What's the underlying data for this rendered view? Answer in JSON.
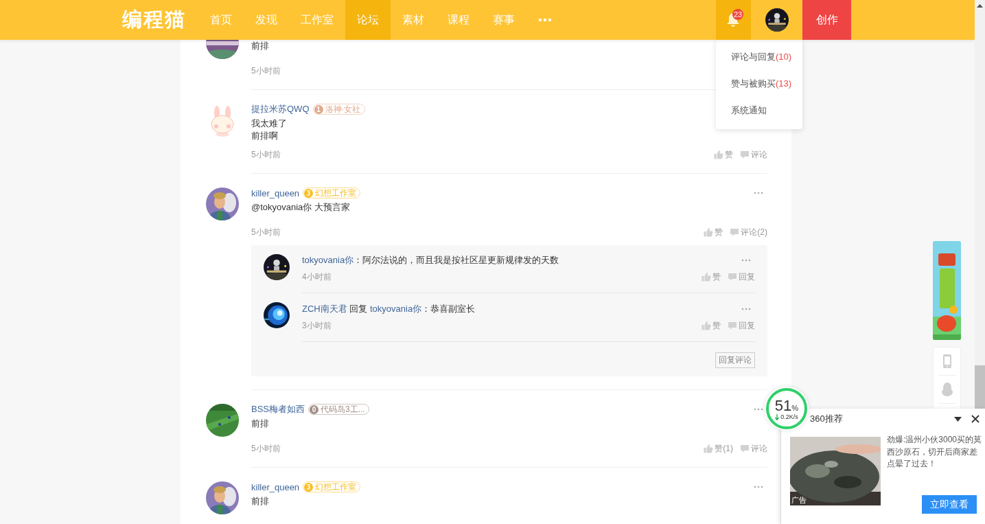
{
  "header": {
    "logo": "编程猫",
    "nav": [
      {
        "label": "首页",
        "selected": false
      },
      {
        "label": "发现",
        "selected": false
      },
      {
        "label": "工作室",
        "selected": false
      },
      {
        "label": "论坛",
        "selected": true
      },
      {
        "label": "素材",
        "selected": false
      },
      {
        "label": "课程",
        "selected": false
      },
      {
        "label": "赛事",
        "selected": false
      }
    ],
    "notifications": {
      "count": "23",
      "expanded": true
    },
    "create_button": "创作"
  },
  "notification_menu": [
    {
      "label": "评论与回复",
      "count": "(10)"
    },
    {
      "label": "赞与被购买",
      "count": "(13)"
    },
    {
      "label": "系统通知"
    }
  ],
  "comments": [
    {
      "body": [
        "前排"
      ],
      "time": "5小时前"
    },
    {
      "author": "提拉米苏QWQ",
      "badge": {
        "rank": "1",
        "label": "洛神·女社",
        "color": "#e2a98c"
      },
      "body": [
        "我太难了",
        "前排啊"
      ],
      "time": "5小时前",
      "actions": [
        {
          "kind": "like",
          "label": "赞"
        },
        {
          "kind": "comment",
          "label": "评论"
        }
      ]
    },
    {
      "author": "killer_queen",
      "badge": {
        "rank": "3",
        "label": "幻想工作室",
        "color": "#f9bd22"
      },
      "more": true,
      "body": [
        "@tokyovania你 大预言家"
      ],
      "time": "5小时前",
      "actions": [
        {
          "kind": "like",
          "label": "赞"
        },
        {
          "kind": "comment",
          "label": "评论(2)"
        }
      ],
      "replies": [
        {
          "author": "tokyovania你",
          "text": "：阿尔法说的，而且我是按社区星更新规律发的天数",
          "time": "4小时前",
          "actions": [
            {
              "kind": "like",
              "label": "赞"
            },
            {
              "kind": "reply",
              "label": "回复"
            }
          ]
        },
        {
          "author": "ZCH南天君",
          "reply_word": "回复",
          "target": "tokyovania你",
          "text": "：恭喜副室长",
          "time": "3小时前",
          "actions": [
            {
              "kind": "like",
              "label": "赞"
            },
            {
              "kind": "reply",
              "label": "回复"
            }
          ]
        }
      ],
      "reply_button": "回复评论"
    },
    {
      "author": "BSS梅者如西",
      "badge": {
        "rank": "0",
        "label": "代码岛3工...",
        "color": "#a38e86"
      },
      "more": true,
      "body": [
        "前排"
      ],
      "time": "5小时前",
      "actions": [
        {
          "kind": "like",
          "label": "赞(1)"
        },
        {
          "kind": "comment",
          "label": "评论"
        }
      ]
    },
    {
      "author": "killer_queen",
      "badge": {
        "rank": "3",
        "label": "幻想工作室",
        "color": "#f9bd22"
      },
      "more": true,
      "body": [
        "前排"
      ]
    }
  ],
  "speed_ball": {
    "value": "51",
    "unit": "%",
    "speed": "0.2K/s"
  },
  "ad_popup": {
    "title": "360推荐",
    "picture_label": "广告",
    "text": "劲爆:温州小伙3000买的莫西沙原石，切开后商家差点晕了过去！",
    "button": "立即查看"
  }
}
